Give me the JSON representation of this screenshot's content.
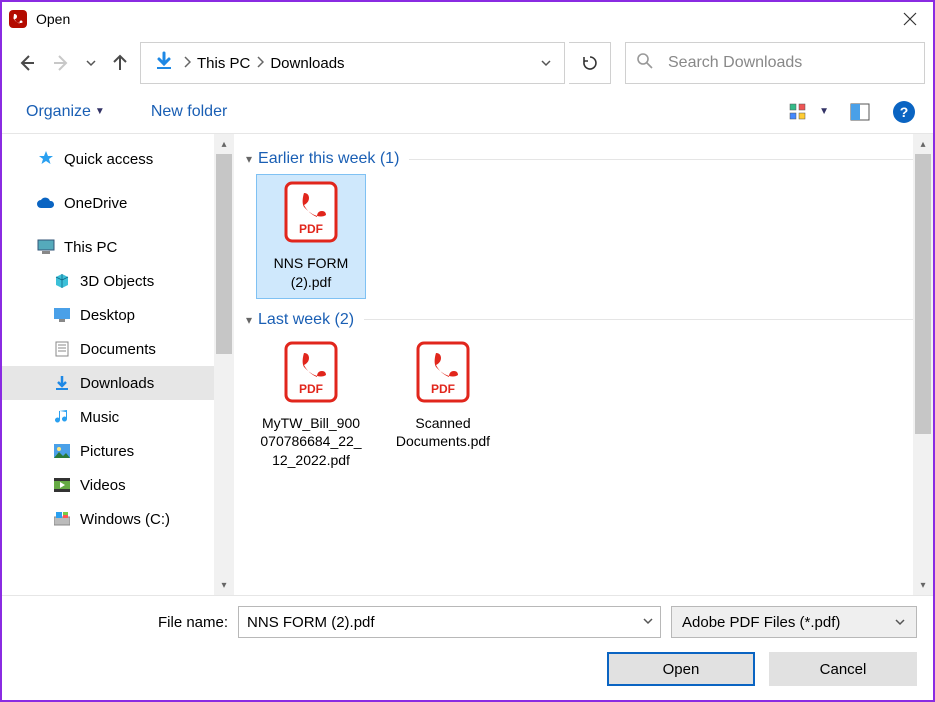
{
  "window": {
    "title": "Open"
  },
  "breadcrumb": {
    "root": "This PC",
    "current": "Downloads"
  },
  "search": {
    "placeholder": "Search Downloads"
  },
  "toolbar": {
    "organize": "Organize",
    "newfolder": "New folder"
  },
  "sidebar": {
    "quick_access": "Quick access",
    "onedrive": "OneDrive",
    "this_pc": "This PC",
    "objects3d": "3D Objects",
    "desktop": "Desktop",
    "documents": "Documents",
    "downloads": "Downloads",
    "music": "Music",
    "pictures": "Pictures",
    "videos": "Videos",
    "windows_c": "Windows (C:)"
  },
  "groups": {
    "earlier_this_week": {
      "label": "Earlier this week (1)"
    },
    "last_week": {
      "label": "Last week (2)"
    }
  },
  "files": {
    "nns_form": "NNS FORM (2).pdf",
    "mytw_bill": "MyTW_Bill_900070786684_22_12_2022.pdf",
    "scanned_docs": "Scanned Documents.pdf"
  },
  "footer": {
    "filename_label": "File name:",
    "filename_value": "NNS FORM (2).pdf",
    "filetype": "Adobe PDF Files (*.pdf)",
    "open": "Open",
    "cancel": "Cancel"
  }
}
